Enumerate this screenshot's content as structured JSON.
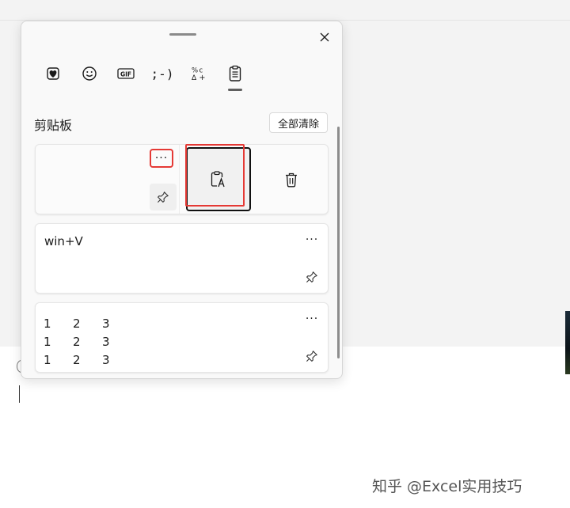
{
  "document": {
    "top_text": "· · · · ·",
    "watermark": "知乎 @Excel实用技巧"
  },
  "panel": {
    "tabs": [
      {
        "name": "favorites",
        "icon": "heart-sticker-icon"
      },
      {
        "name": "emoji",
        "icon": "smiley-icon"
      },
      {
        "name": "gif",
        "label": "GIF",
        "icon": "gif-icon"
      },
      {
        "name": "kaomoji",
        "label": ";-)",
        "icon": "kaomoji-icon"
      },
      {
        "name": "symbols",
        "icon": "symbols-icon"
      },
      {
        "name": "clipboard",
        "icon": "clipboard-icon",
        "active": true
      }
    ],
    "section_title": "剪贴板",
    "clear_all_label": "全部清除",
    "more_label": "···",
    "cards": [
      {
        "text": "",
        "menu_open": true
      },
      {
        "text": "win+V"
      },
      {
        "rows": [
          [
            "1",
            "2",
            "3"
          ],
          [
            "1",
            "2",
            "3"
          ],
          [
            "1",
            "2",
            "3"
          ]
        ]
      }
    ]
  },
  "colors": {
    "highlight": "#e53935",
    "panel_bg": "#f9f9f9",
    "card_bg": "#ffffff"
  }
}
